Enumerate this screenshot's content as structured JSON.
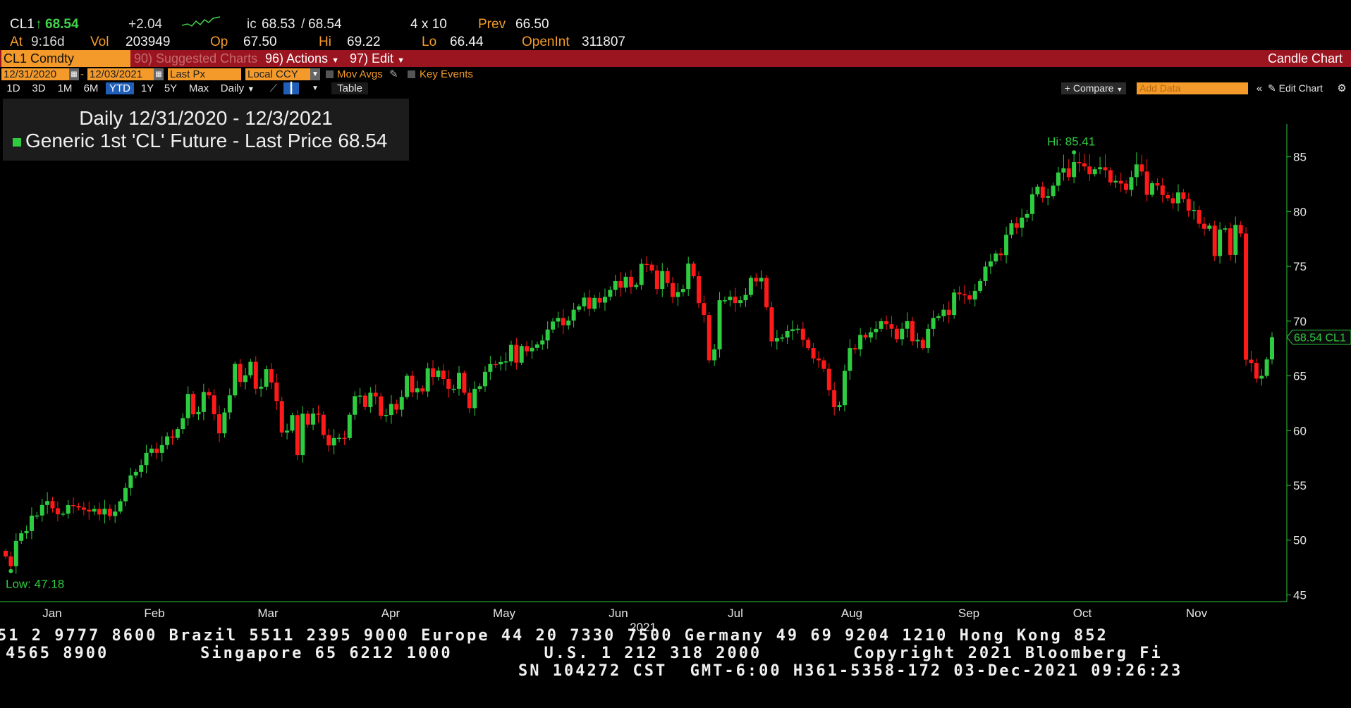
{
  "header": {
    "ticker": "CL1",
    "last": "68.54",
    "change": "+2.04",
    "bid_ask_prefix": "ic",
    "bid": "68.53",
    "ask": "68.54",
    "size": "4 x 10",
    "prev_label": "Prev",
    "prev": "66.50",
    "at_label": "At",
    "time": "9:16d",
    "vol_label": "Vol",
    "vol": "203949",
    "op_label": "Op",
    "op": "67.50",
    "hi_label": "Hi",
    "hi": "69.22",
    "lo_label": "Lo",
    "lo": "66.44",
    "openint_label": "OpenInt",
    "openint": "311807"
  },
  "menubar": {
    "security": "CL1 Comdty",
    "suggested": "90) Suggested Charts",
    "actions": "96) Actions",
    "edit": "97) Edit",
    "chart_type": "Candle Chart"
  },
  "options": {
    "start_date": "12/31/2020",
    "end_date": "12/03/2021",
    "field": "Last Px",
    "currency": "Local CCY",
    "mov_avgs": "Mov Avgs",
    "key_events": "Key Events"
  },
  "ranges": {
    "buttons": [
      "1D",
      "3D",
      "1M",
      "6M",
      "YTD",
      "1Y",
      "5Y",
      "Max"
    ],
    "selected": "YTD",
    "frequency": "Daily",
    "table": "Table",
    "compare": "+ Compare",
    "add_data_placeholder": "Add Data",
    "edit_chart": "Edit Chart"
  },
  "legend": {
    "line1": "Daily 12/31/2020 - 12/3/2021",
    "series": "Generic 1st 'CL' Future - Last Price",
    "value": "68.54"
  },
  "chart_data": {
    "type": "candlestick",
    "title": "Daily 12/31/2020 - 12/3/2021",
    "series_name": "Generic 1st 'CL' Future - Last Price",
    "last_value": 68.54,
    "last_label": "68.54 CL1",
    "ylim": [
      44,
      88
    ],
    "yticks": [
      45,
      50,
      55,
      60,
      65,
      70,
      75,
      80,
      85
    ],
    "x_months": [
      "Jan",
      "Feb",
      "Mar",
      "Apr",
      "May",
      "Jun",
      "Jul",
      "Aug",
      "Sep",
      "Oct",
      "Nov"
    ],
    "x_year": "2021",
    "high_annotation": "Hi: 85.41",
    "high_value": 85.41,
    "low_annotation": "Low: 47.18",
    "low_value": 47.18,
    "colors": {
      "up": "#2ecc40",
      "down": "#ff1a1a",
      "axis": "#2ecc40",
      "annotation": "#2ecc40"
    },
    "closes": [
      48.52,
      47.62,
      49.93,
      50.63,
      50.83,
      52.24,
      52.25,
      53.21,
      53.57,
      52.91,
      52.36,
      52.42,
      53.2,
      53.13,
      52.98,
      52.77,
      52.61,
      52.85,
      52.34,
      52.87,
      52.2,
      52.61,
      53.55,
      54.76,
      55.91,
      56.23,
      56.85,
      57.97,
      58.36,
      57.97,
      58.68,
      59.47,
      59.34,
      60.14,
      61.14,
      63.35,
      61.49,
      61.7,
      63.53,
      63.22,
      61.5,
      59.75,
      61.66,
      63.22,
      66.09,
      64.44,
      65.05,
      66.28,
      63.83,
      64.01,
      65.61,
      64.39,
      62.7,
      59.83,
      60.0,
      61.42,
      57.76,
      61.55,
      60.55,
      61.56,
      61.45,
      59.6,
      58.65,
      59.32,
      59.34,
      59.32,
      61.45,
      63.15,
      63.2,
      62.15,
      63.46,
      63.13,
      61.35,
      61.43,
      62.44,
      61.91,
      63.07,
      65.01,
      63.5,
      63.86,
      63.58,
      65.69,
      64.9,
      65.49,
      64.71,
      63.82,
      63.82,
      65.28,
      63.46,
      62.05,
      63.82,
      64.05,
      65.37,
      66.08,
      66.05,
      66.27,
      66.32,
      67.83,
      66.21,
      67.72,
      67.24,
      67.56,
      67.87,
      68.23,
      69.23,
      69.96,
      70.29,
      69.62,
      70.05,
      71.04,
      71.35,
      72.15,
      71.12,
      72.12,
      71.69,
      72.22,
      72.85,
      73.66,
      73.05,
      74.05,
      73.12,
      73.3,
      75.23,
      75.16,
      74.62,
      72.94,
      74.56,
      73.47,
      72.2,
      72.65,
      72.94,
      75.25,
      74.1,
      71.65,
      70.56,
      66.42,
      67.42,
      71.91,
      71.91,
      72.23,
      71.65,
      71.91,
      72.39,
      73.95,
      73.62,
      73.95,
      71.26,
      68.15,
      68.44,
      68.5,
      69.09,
      69.25,
      69.3,
      68.29,
      67.54,
      66.59,
      66.42,
      65.64,
      63.69,
      62.14,
      62.32,
      65.46,
      67.54,
      67.42,
      68.74,
      68.5,
      68.99,
      69.29,
      69.99,
      69.72,
      69.3,
      68.35,
      69.3,
      69.99,
      68.16,
      68.29,
      67.54,
      69.29,
      70.29,
      70.45,
      71.04,
      70.56,
      72.61,
      72.46,
      72.35,
      71.97,
      72.76,
      73.66,
      74.98,
      75.45,
      76.18,
      76.02,
      77.88,
      78.93,
      78.52,
      79.45,
      79.78,
      81.58,
      82.28,
      81.26,
      81.42,
      82.37,
      83.57,
      83.95,
      83.15,
      84.53,
      84.41,
      84.12,
      83.42,
      83.87,
      84.05,
      83.78,
      82.66,
      82.81,
      82.56,
      81.98,
      83.15,
      84.31,
      83.66,
      81.53,
      82.59,
      82.38,
      81.51,
      81.22,
      80.76,
      81.75,
      81.15,
      80.09,
      80.15,
      78.89,
      78.43,
      78.72,
      75.94,
      78.36,
      78.47,
      76.04,
      78.79,
      78.0,
      66.48,
      66.18,
      64.75,
      65.0,
      66.5,
      68.54
    ]
  },
  "footer": {
    "line1": "51 2 9777 8600 Brazil 5511 2395 9000 Europe 44 20 7330 7500 Germany 49 69 9204 1210 Hong Kong 852",
    "line2": "4565 8900        Singapore 65 6212 1000        U.S. 1 212 318 2000        Copyright 2021 Bloomberg Fi",
    "line3": "SN 104272 CST  GMT-6:00 H361-5358-172 03-Dec-2021 09:26:23"
  }
}
